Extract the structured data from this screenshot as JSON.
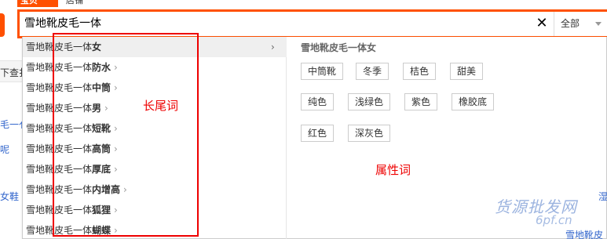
{
  "tabs": [
    {
      "label": "宝贝",
      "active": true
    },
    {
      "label": "店铺",
      "active": false
    }
  ],
  "search": {
    "value": "雪地靴皮毛一体",
    "clear_glyph": "✕",
    "scope": "全部"
  },
  "background": {
    "strip_text": "下查扌",
    "fragments": [
      "毛一亻",
      "呢",
      "女鞋",
      "湿",
      "毛一",
      "雪地靴皮"
    ]
  },
  "suggestions": {
    "items": [
      {
        "prefix": "雪地靴皮毛一体",
        "suffix": "女"
      },
      {
        "prefix": "雪地靴皮毛一体",
        "suffix": "防水"
      },
      {
        "prefix": "雪地靴皮毛一体",
        "suffix": "中筒"
      },
      {
        "prefix": "雪地靴皮毛一体",
        "suffix": "男"
      },
      {
        "prefix": "雪地靴皮毛一体",
        "suffix": "短靴"
      },
      {
        "prefix": "雪地靴皮毛一体",
        "suffix": "高筒"
      },
      {
        "prefix": "雪地靴皮毛一体",
        "suffix": "厚底"
      },
      {
        "prefix": "雪地靴皮毛一体",
        "suffix": "内增高"
      },
      {
        "prefix": "雪地靴皮毛一体",
        "suffix": "狐狸"
      },
      {
        "prefix": "雪地靴皮毛一体",
        "suffix": "蝴蝶"
      }
    ],
    "chevron": "›"
  },
  "attributes": {
    "title": "雪地靴皮毛一体女",
    "tags": [
      "中筒靴",
      "冬季",
      "桔色",
      "甜美",
      "纯色",
      "浅绿色",
      "紫色",
      "橡胶底",
      "红色",
      "深灰色"
    ]
  },
  "annotations": {
    "long_tail": "长尾词",
    "attribute_words": "属性词"
  },
  "watermark": {
    "line1": "货源批发网",
    "line2": "6pf.cn"
  },
  "colors": {
    "brand": "#ff5000",
    "annotation": "#ee0000"
  }
}
